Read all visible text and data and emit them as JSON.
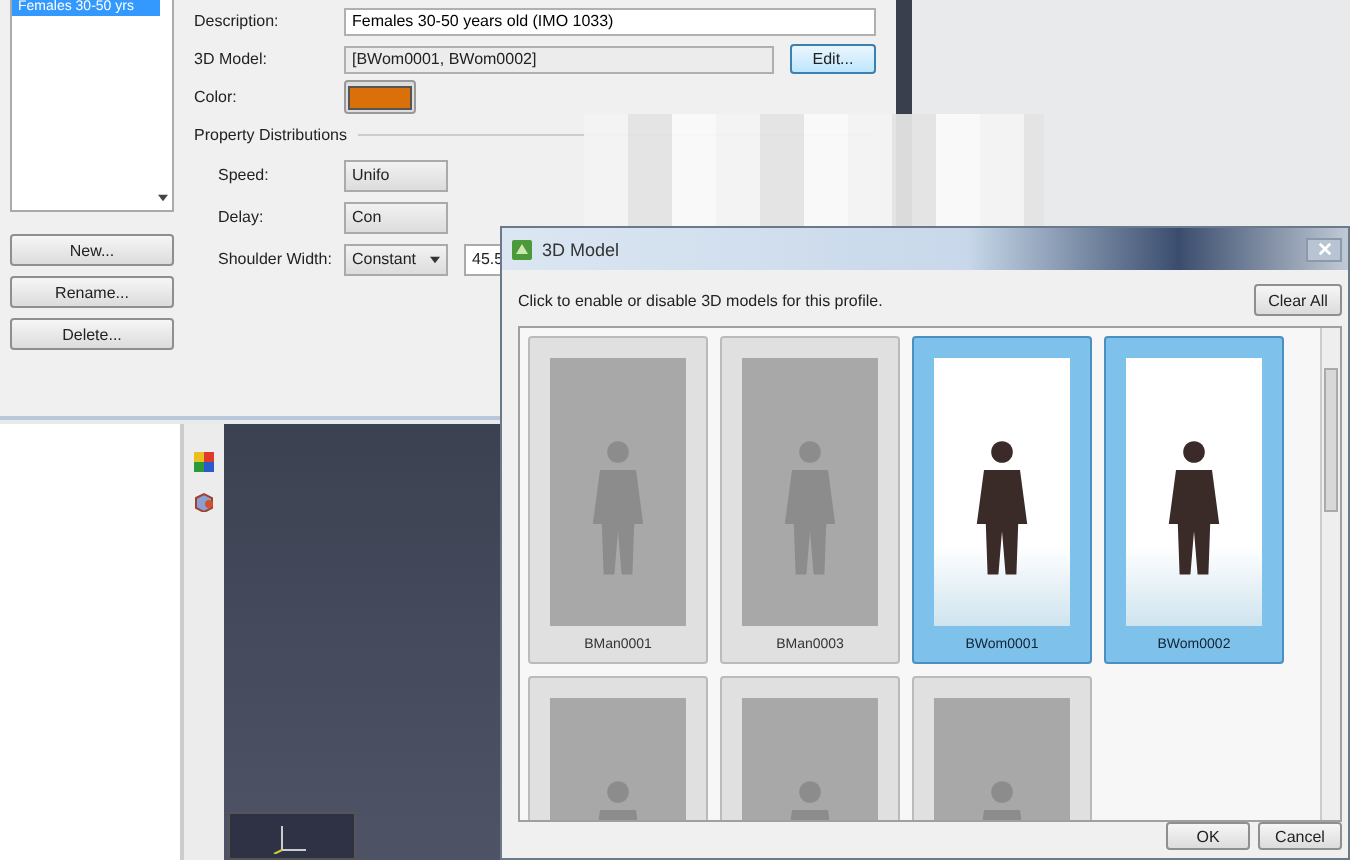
{
  "profile_dialog": {
    "profiles": [
      {
        "label": "Females 30-50 yrs",
        "selected": true
      }
    ],
    "buttons": [
      "New...",
      "Rename...",
      "Delete..."
    ],
    "description": {
      "label": "Description:",
      "value": "Females 30-50 years old (IMO 1033)"
    },
    "model": {
      "label": "3D Model:",
      "value": "[BWom0001, BWom0002]",
      "button": "Edit..."
    },
    "color": {
      "label": "Color:",
      "color": "#d9700a"
    },
    "section": "Property Distributions",
    "distributions": [
      {
        "label": "Speed:",
        "value": "Unifo"
      },
      {
        "label": "Delay:",
        "value": "Con"
      },
      {
        "label": "Shoulder Width:",
        "value": "Constant",
        "number": "45.5"
      }
    ]
  },
  "model_dialog": {
    "title": "3D Model",
    "instruction": "Click to enable or disable 3D models for this profile.",
    "clear_button": "Clear All",
    "models": [
      {
        "name": "BMan0001",
        "selected": false
      },
      {
        "name": "BMan0003",
        "selected": false
      },
      {
        "name": "BWom0001",
        "selected": true
      },
      {
        "name": "BWom0002",
        "selected": true
      },
      {
        "selected": false
      },
      {
        "selected": false
      },
      {
        "selected": false
      }
    ],
    "buttons": [
      "OK",
      "Cancel"
    ]
  }
}
